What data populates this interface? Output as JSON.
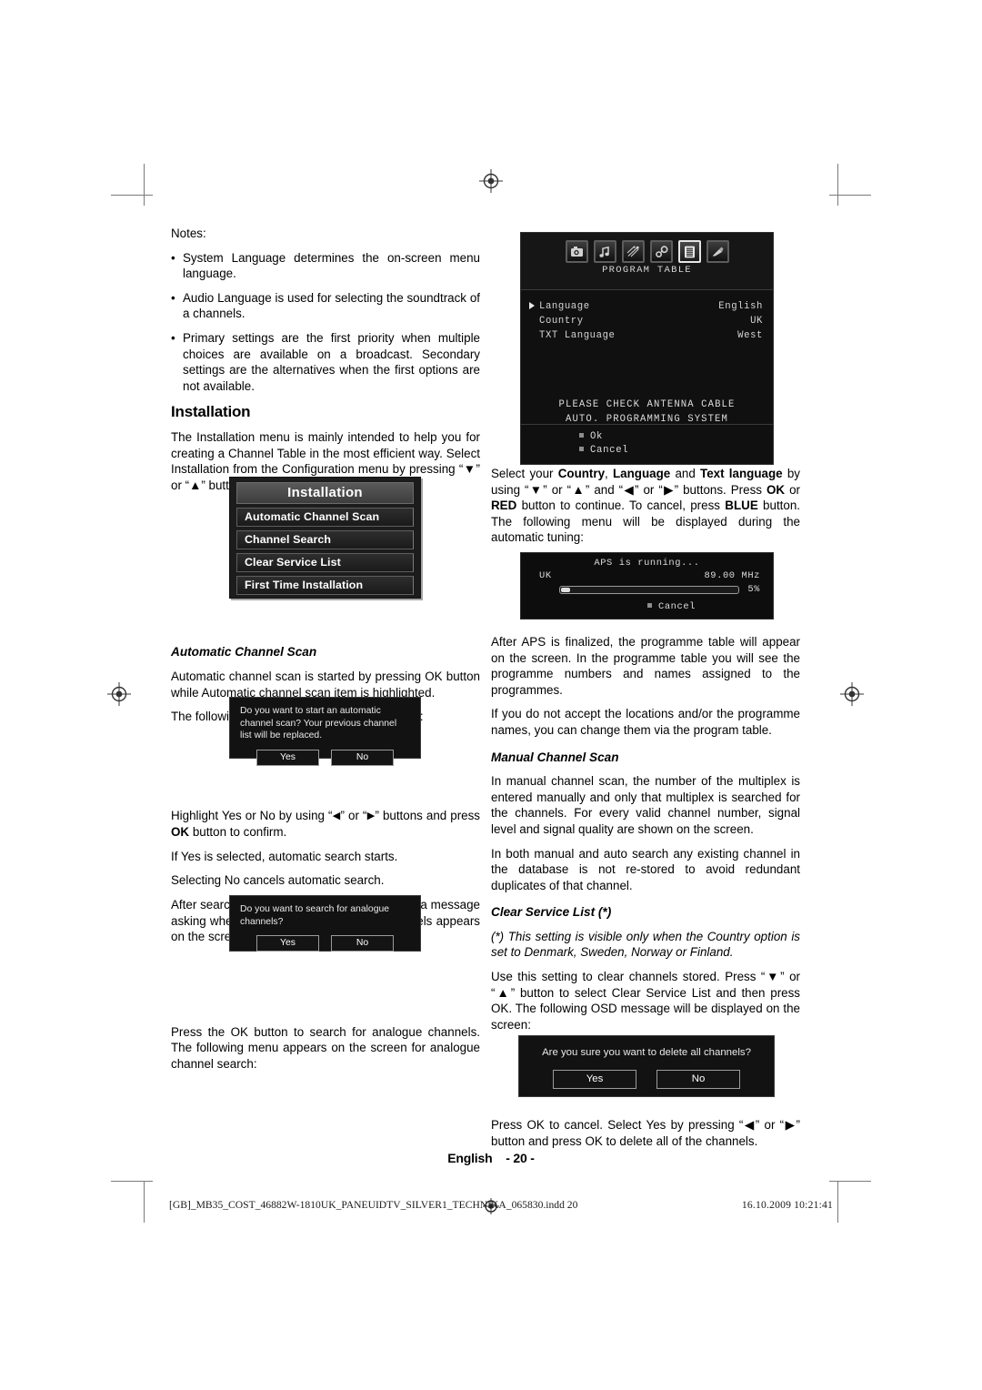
{
  "notes": {
    "heading": "Notes:",
    "items": [
      "System Language determines the on-screen menu language.",
      "Audio Language is used for selecting the soundtrack of a channels.",
      "Primary settings are the first priority when multiple choices are available on a broadcast. Secondary settings are the alternatives when the first options are not available."
    ]
  },
  "installation_section": {
    "heading": "Installation",
    "intro": "The Installation menu is mainly intended to help you for creating a Channel Table in the most efficient way. Select Installation from the Configuration menu by pressing “▼” or “▲” buttons."
  },
  "installation_menu": {
    "title": "Installation",
    "items": [
      "Automatic Channel Scan",
      "Channel Search",
      "Clear Service List",
      "First Time Installation"
    ]
  },
  "automatic_channel_scan": {
    "heading": "Automatic Channel Scan",
    "p1": "Automatic channel scan is started by pressing OK button while Automatic channel scan item is highlighted.",
    "p2": "The following message appears on the screen:",
    "p3_a": "Highlight Yes or No by using “",
    "p3_b": "” or “",
    "p3_c": "” buttons and press ",
    "p3_ok": "OK",
    "p3_d": " button to confirm.",
    "p4": "If Yes is selected, automatic search starts.",
    "p5": "Selecting No cancels automatic search.",
    "p6": "After search is completed for digital channels, a message asking whether to search for analogue channels appears on the screen:",
    "p7": "Press the OK button to search for analogue channels. The following menu appears on the screen for analogue channel search:"
  },
  "dialog_auto_scan": {
    "message": "Do you want to start an automatic channel scan? Your previous channel list will be replaced.",
    "yes": "Yes",
    "no": "No"
  },
  "dialog_analogue": {
    "message": "Do you want to search for analogue channels?",
    "yes": "Yes",
    "no": "No"
  },
  "dialog_delete": {
    "message": "Are you sure you want to delete all channels?",
    "yes": "Yes",
    "no": "No"
  },
  "program_table_osd": {
    "title": "PROGRAM TABLE",
    "icons": [
      "picture-icon",
      "sound-icon",
      "feature-icon",
      "install-icon",
      "program-table-icon",
      "source-icon"
    ],
    "rows": [
      {
        "label": "Language",
        "value": "English",
        "selected": true
      },
      {
        "label": "Country",
        "value": "UK",
        "selected": false
      },
      {
        "label": "TXT Language",
        "value": "West",
        "selected": false
      }
    ],
    "notice_line1": "PLEASE CHECK ANTENNA CABLE",
    "notice_line2": "AUTO. PROGRAMMING SYSTEM",
    "ok": "Ok",
    "cancel": "Cancel"
  },
  "aps_osd": {
    "title": "APS is running...",
    "country": "UK",
    "frequency": "89.00 MHz",
    "percent": "5%",
    "progress": 5,
    "cancel": "Cancel"
  },
  "right_column": {
    "p1_a": "Select your ",
    "p1_country": "Country",
    "p1_b": ", ",
    "p1_language": "Language",
    "p1_c": " and ",
    "p1_text": "Text language",
    "p1_d": " by using “▼” or “▲” and “◀” or “▶” buttons. Press ",
    "p1_ok": "OK",
    "p1_e": " or ",
    "p1_red": "RED",
    "p1_f": " button to continue. To cancel, press ",
    "p1_blue": "BLUE",
    "p1_g": " button. The following menu will be displayed during the automatic tuning:",
    "p2": "After APS is finalized, the programme table will appear on the screen. In the programme table you will see the programme numbers and names assigned to the programmes.",
    "p3": "If you do not accept the locations and/or the programme names, you can change them via the program table.",
    "manual_heading": "Manual Channel Scan",
    "p4": "In manual channel scan, the number of the multiplex is entered manually and only that multiplex is searched for the channels. For every valid channel number, signal level and signal quality are shown on the screen.",
    "p5": "In both manual and auto search any existing channel in the database is not re-stored to avoid redundant duplicates of that channel.",
    "clear_heading": "Clear Service List (*)",
    "p6": "(*) This setting is visible only when the Country option is set to Denmark, Sweden, Norway or Finland.",
    "p7": "Use this setting to clear channels stored. Press “▼” or “▲” button to select Clear Service List and then press OK. The following OSD message will be displayed on the screen:",
    "p8": "Press OK to cancel. Select Yes by pressing “◀” or “▶” button and press OK to delete all of the channels."
  },
  "footer": {
    "language": "English",
    "page": "- 20 -",
    "file": "[GB]_MB35_COST_46882W-1810UK_PANEUIDTV_SILVER1_TECHNIKA_065830.indd   20",
    "timestamp": "16.10.2009   10:21:41"
  }
}
